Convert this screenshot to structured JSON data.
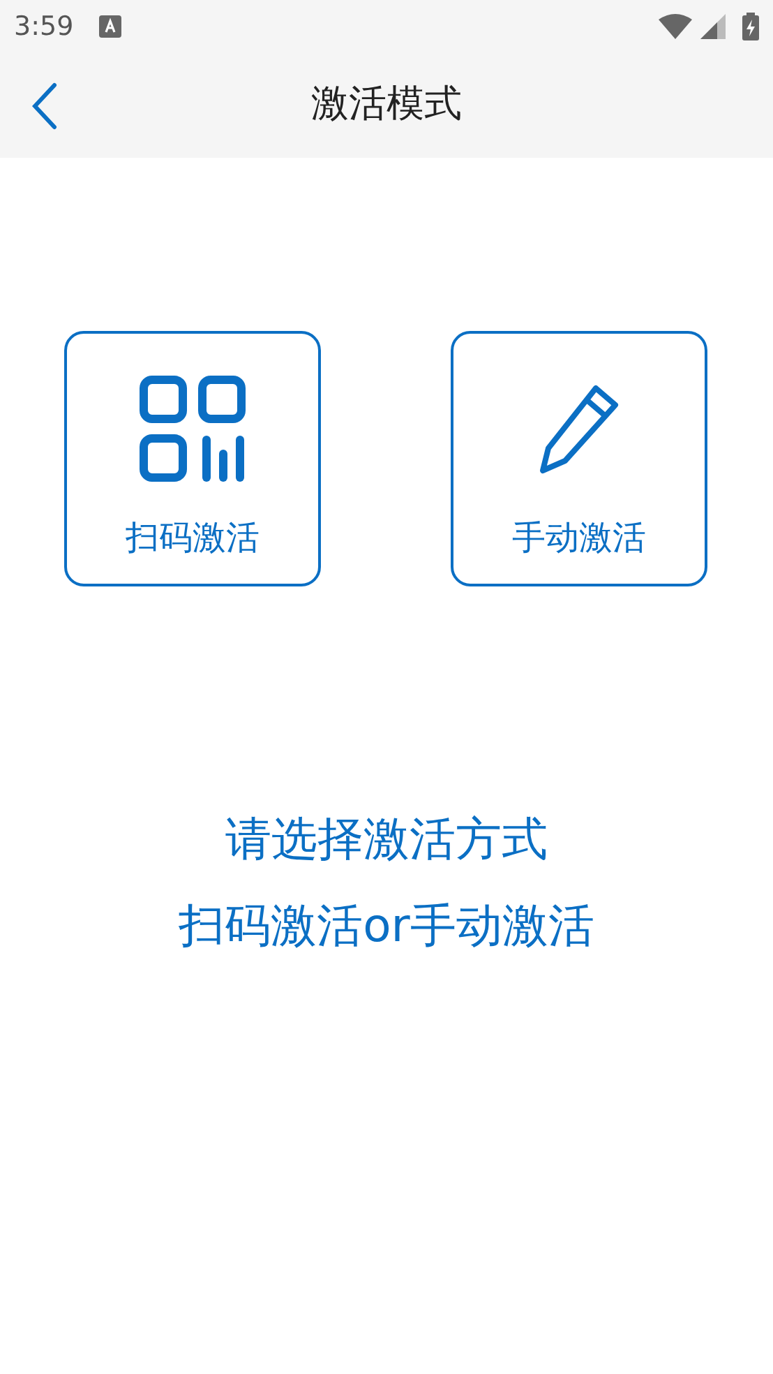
{
  "status_bar": {
    "time": "3:59"
  },
  "app_bar": {
    "title": "激活模式"
  },
  "options": [
    {
      "kind": "qr",
      "label": "扫码激活"
    },
    {
      "kind": "pencil",
      "label": "手动激活"
    }
  ],
  "hint": [
    "请选择激活方式",
    "扫码激活or手动激活"
  ]
}
